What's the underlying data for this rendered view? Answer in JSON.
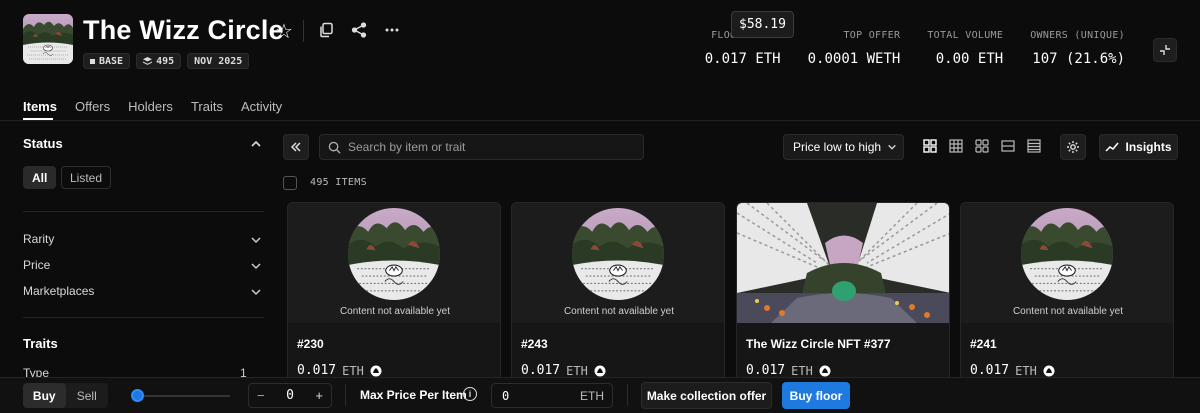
{
  "collection": {
    "name": "The Wizz Circle",
    "badges": {
      "chain": "BASE",
      "items": "495",
      "date": "NOV 2025"
    }
  },
  "tooltip": "$58.19",
  "stats": [
    {
      "label": "FLOOR PRICE",
      "value": "0.017 ETH"
    },
    {
      "label": "TOP OFFER",
      "value": "0.0001 WETH"
    },
    {
      "label": "TOTAL VOLUME",
      "value": "0.00 ETH"
    },
    {
      "label": "OWNERS (UNIQUE)",
      "value": "107 (21.6%)"
    }
  ],
  "tabs": [
    "Items",
    "Offers",
    "Holders",
    "Traits",
    "Activity"
  ],
  "sidebar": {
    "status_title": "Status",
    "status_options": [
      "All",
      "Listed"
    ],
    "filters": [
      "Rarity",
      "Price",
      "Marketplaces"
    ],
    "traits_title": "Traits",
    "traits": [
      {
        "label": "Type",
        "count": "1"
      }
    ]
  },
  "toolbar": {
    "search_placeholder": "Search by item or trait",
    "sort": "Price low to high",
    "insights": "Insights",
    "item_count": "495 ITEMS"
  },
  "cards": [
    {
      "name": "#230",
      "price": "0.017",
      "unit": "ETH",
      "placeholder": "Content not available yet"
    },
    {
      "name": "#243",
      "price": "0.017",
      "unit": "ETH",
      "placeholder": "Content not available yet"
    },
    {
      "name": "The Wizz Circle NFT #377",
      "price": "0.017",
      "unit": "ETH",
      "placeholder": ""
    },
    {
      "name": "#241",
      "price": "0.017",
      "unit": "ETH",
      "placeholder": "Content not available yet"
    }
  ],
  "bottom": {
    "buy": "Buy",
    "sell": "Sell",
    "quantity": "0",
    "minus": "−",
    "plus": "+",
    "max_price_label": "Max Price Per Item",
    "max_price_value": "0",
    "max_price_unit": "ETH",
    "make_offer": "Make collection offer",
    "buy_floor": "Buy floor"
  },
  "colors": {
    "accent": "#1f7ae0",
    "background": "#0c0c0c"
  }
}
